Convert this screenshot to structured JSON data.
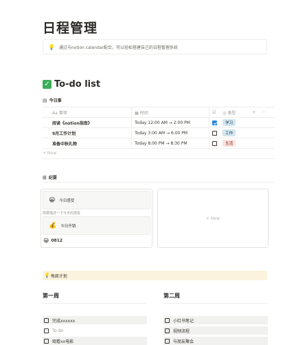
{
  "page": {
    "title": "日程管理",
    "callout": {
      "icon": "lightbulb-icon",
      "text": "通过与notion calendar配合，可以轻松搭建自己的日程管理系统"
    }
  },
  "todo_section": {
    "icon": "check-mark-icon",
    "heading": "To-do list",
    "table_view": {
      "view_icon": "▤",
      "view_name": "今日事",
      "columns": {
        "name": "Aa 事项",
        "time": "时间",
        "done": "☑",
        "type": "◎ 类型",
        "add": "+",
        "more": "···"
      },
      "rows": [
        {
          "name": "阅读《notion指南》",
          "time": "Today 12:00 AM → 2:00 PM",
          "done": true,
          "type": "学习",
          "type_bg": "#d3e5ef",
          "type_fg": "#183347"
        },
        {
          "name": "9月工作计划",
          "time": "Today 3:00 AM → 6:00 PM",
          "done": false,
          "type": "工作",
          "type_bg": "#d3e5ef",
          "type_fg": "#183347"
        },
        {
          "name": "准备中秋礼物",
          "time": "Today 8:00 PM → 8:30 PM",
          "done": false,
          "type": "生活",
          "type_bg": "#ffe2dd",
          "type_fg": "#5d1715"
        }
      ],
      "new_label": "+ New"
    }
  },
  "gallery": {
    "view_icon": "⊞",
    "view_name": "纪要",
    "card": {
      "block1": {
        "emoji": "😀",
        "label": "今日感受"
      },
      "hint": "简要描述一下今天的感受",
      "block2": {
        "emoji": "💰",
        "label": "今日开销"
      },
      "title_emoji": "😀",
      "title": "0812"
    },
    "new_label": "+ New"
  },
  "weekly": {
    "emoji": "💡",
    "label": "每周计划",
    "weeks": [
      {
        "heading": "第一周",
        "items": [
          {
            "text": "完成xxxxxx",
            "placeholder": false
          },
          {
            "text": "To-do",
            "placeholder": true
          },
          {
            "text": "观看xx电影",
            "placeholder": false
          }
        ]
      },
      {
        "heading": "第二周",
        "items": [
          {
            "text": "小红书笔记",
            "placeholder": false
          },
          {
            "text": "视频流程",
            "placeholder": false
          },
          {
            "text": "与朋友聚会",
            "placeholder": false
          }
        ]
      }
    ]
  }
}
